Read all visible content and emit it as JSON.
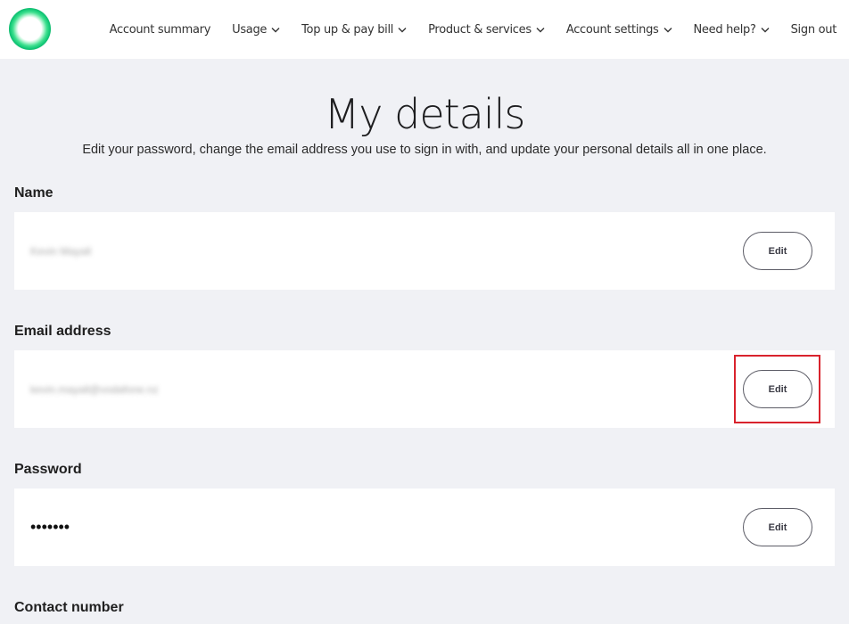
{
  "header": {
    "logo": "brand-ring-logo",
    "nav": [
      {
        "label": "Account summary",
        "has_chevron": false
      },
      {
        "label": "Usage",
        "has_chevron": true
      },
      {
        "label": "Top up & pay bill",
        "has_chevron": true
      },
      {
        "label": "Product & services",
        "has_chevron": true
      },
      {
        "label": "Account settings",
        "has_chevron": true
      },
      {
        "label": "Need help?",
        "has_chevron": true
      },
      {
        "label": "Sign out",
        "has_chevron": false
      }
    ]
  },
  "page": {
    "title": "My details",
    "subtitle": "Edit your password, change the email address you use to sign in with, and update your personal details all in one place."
  },
  "sections": {
    "name": {
      "label": "Name",
      "value": "Kevin Mayall",
      "edit_label": "Edit"
    },
    "email": {
      "label": "Email address",
      "value": "kevin.mayall@vodafone.nz",
      "edit_label": "Edit"
    },
    "password": {
      "label": "Password",
      "value": "•••••••",
      "edit_label": "Edit"
    },
    "contact": {
      "label": "Contact number"
    }
  },
  "colors": {
    "page_bg": "#f0f1f5",
    "card_bg": "#ffffff",
    "highlight": "#d9232d",
    "logo_green": "#14c978"
  }
}
